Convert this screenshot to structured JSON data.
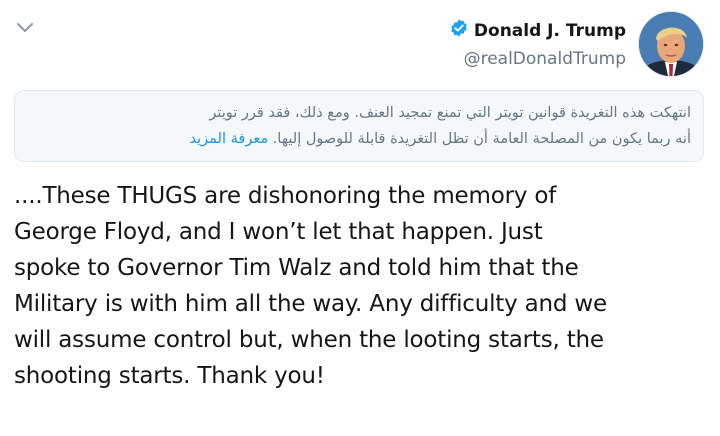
{
  "author": {
    "name": "Donald J. Trump",
    "handle": "@realDonaldTrump",
    "verified": true
  },
  "notice": {
    "line1": "انتهكت هذه التغريدة قوانين تويتر التي تمنع تمجيد العنف. ومع ذلك، فقد قرر تويتر",
    "line2_text": "أنه ربما يكون من المصلحة العامة أن تظل التغريدة قابلة للوصول إليها.",
    "learn_more": "معرفة المزيد"
  },
  "tweet": {
    "lines": [
      "....These THUGS are dishonoring the memory of",
      "George Floyd, and I won’t let that happen. Just",
      "spoke to Governor Tim Walz and told him that the",
      "Military is with him all the way. Any difficulty and we",
      "will assume control but, when the looting starts, the",
      "shooting starts. Thank you!"
    ]
  },
  "colors": {
    "verified_badge": "#1da1f2",
    "link": "#1b95e0",
    "secondary_text": "#657786",
    "notice_background": "#f5f8fa"
  },
  "icons": {
    "menu": "chevron-down-icon",
    "verified": "verified-badge-icon"
  }
}
